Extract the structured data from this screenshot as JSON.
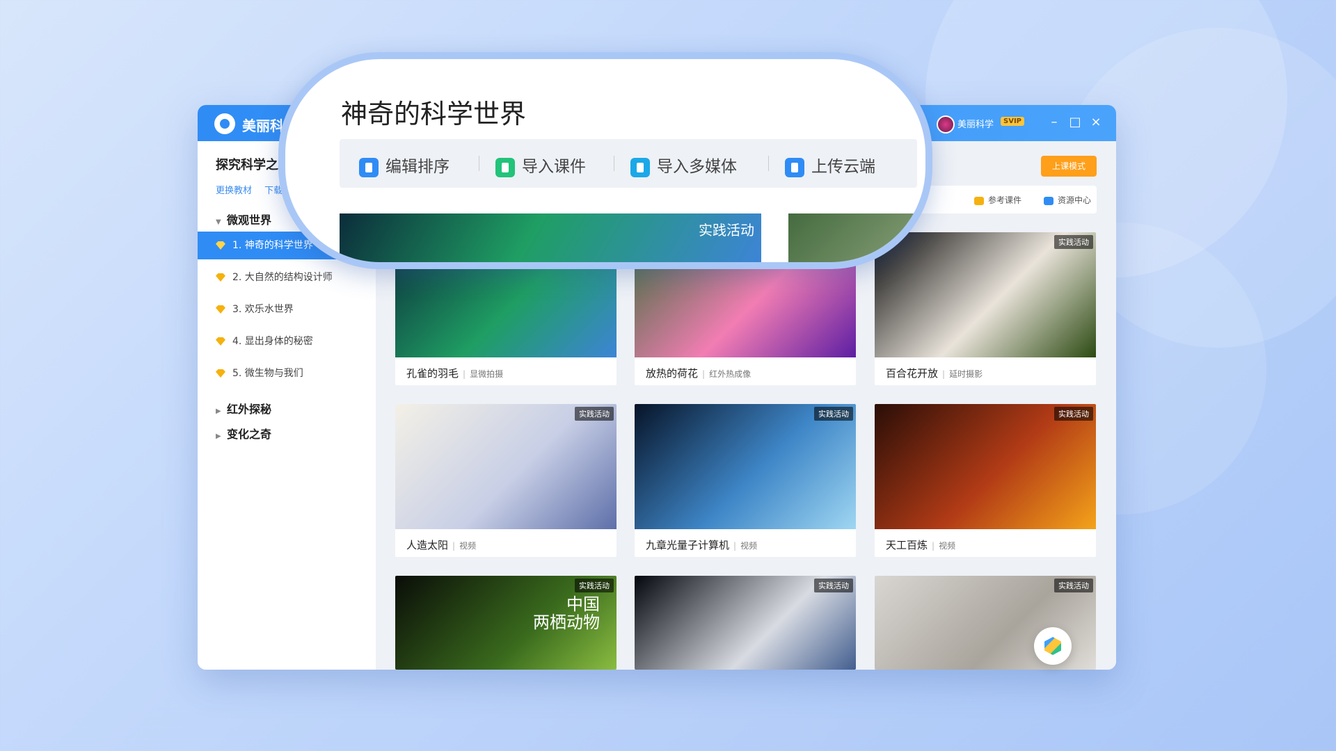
{
  "app": {
    "name": "美丽科学",
    "user": {
      "name": "美丽科学",
      "badge": "SVIP"
    },
    "window_controls": [
      "minimize",
      "maximize",
      "close"
    ]
  },
  "sidebar": {
    "book_title": "探究科学之旅",
    "links": [
      "更换教材",
      "下载"
    ],
    "sections": [
      {
        "label": "微观世界",
        "expanded": true,
        "lessons": [
          {
            "label": "1. 神奇的科学世界",
            "active": true
          },
          {
            "label": "2. 大自然的结构设计师",
            "active": false
          },
          {
            "label": "3. 欢乐水世界",
            "active": false
          },
          {
            "label": "4. 显出身体的秘密",
            "active": false
          },
          {
            "label": "5. 微生物与我们",
            "active": false
          }
        ]
      },
      {
        "label": "红外探秘",
        "expanded": false
      },
      {
        "label": "变化之奇",
        "expanded": false
      }
    ]
  },
  "content": {
    "mode_button": "上课模式",
    "ref_links": [
      "参考课件",
      "资源中心"
    ],
    "cards": [
      {
        "title": "孔雀的羽毛",
        "kind": "显微拍摄",
        "tag": "",
        "colors": [
          "#0b2d3b",
          "#1f9e63",
          "#3d84d6"
        ]
      },
      {
        "title": "放热的荷花",
        "kind": "红外热成像",
        "tag": "",
        "colors": [
          "#3d6e3a",
          "#f27db3",
          "#5c1ea3"
        ]
      },
      {
        "title": "百合花开放",
        "kind": "延时摄影",
        "tag": "实践活动",
        "colors": [
          "#060606",
          "#e9e3da",
          "#2c4a12"
        ]
      },
      {
        "title": "人造太阳",
        "kind": "视频",
        "tag": "实践活动",
        "colors": [
          "#f3f0e6",
          "#c8cfe6",
          "#5e6fa9"
        ]
      },
      {
        "title": "九章光量子计算机",
        "kind": "视频",
        "tag": "实践活动",
        "colors": [
          "#071428",
          "#3e86c7",
          "#9fd6f2"
        ]
      },
      {
        "title": "天工百炼",
        "kind": "视频",
        "tag": "实践活动",
        "colors": [
          "#2a0e07",
          "#b23b16",
          "#f4a31a"
        ]
      },
      {
        "title": "中国两栖动物",
        "kind": "",
        "tag": "实践活动",
        "overlay": "中国\n两栖动物",
        "colors": [
          "#0a0d08",
          "#3a6b1d",
          "#9ed14a"
        ]
      },
      {
        "title": "",
        "kind": "",
        "tag": "实践活动",
        "colors": [
          "#03060d",
          "#d8dbe2",
          "#1d3f7a"
        ]
      },
      {
        "title": "",
        "kind": "",
        "tag": "实践活动",
        "colors": [
          "#d9d6d2",
          "#a9a49c",
          "#eeece8"
        ]
      }
    ]
  },
  "zoom": {
    "title": "神奇的科学世界",
    "toolbar": [
      {
        "label": "编辑排序",
        "icon": "edit-sort-icon",
        "color": "#2f8cf5"
      },
      {
        "label": "导入课件",
        "icon": "import-courseware-icon",
        "color": "#22c37a"
      },
      {
        "label": "导入多媒体",
        "icon": "import-media-icon",
        "color": "#1ca8e8"
      },
      {
        "label": "上传云端",
        "icon": "cloud-upload-icon",
        "color": "#2f8cf5"
      }
    ],
    "banner_tag": "实践活动"
  }
}
